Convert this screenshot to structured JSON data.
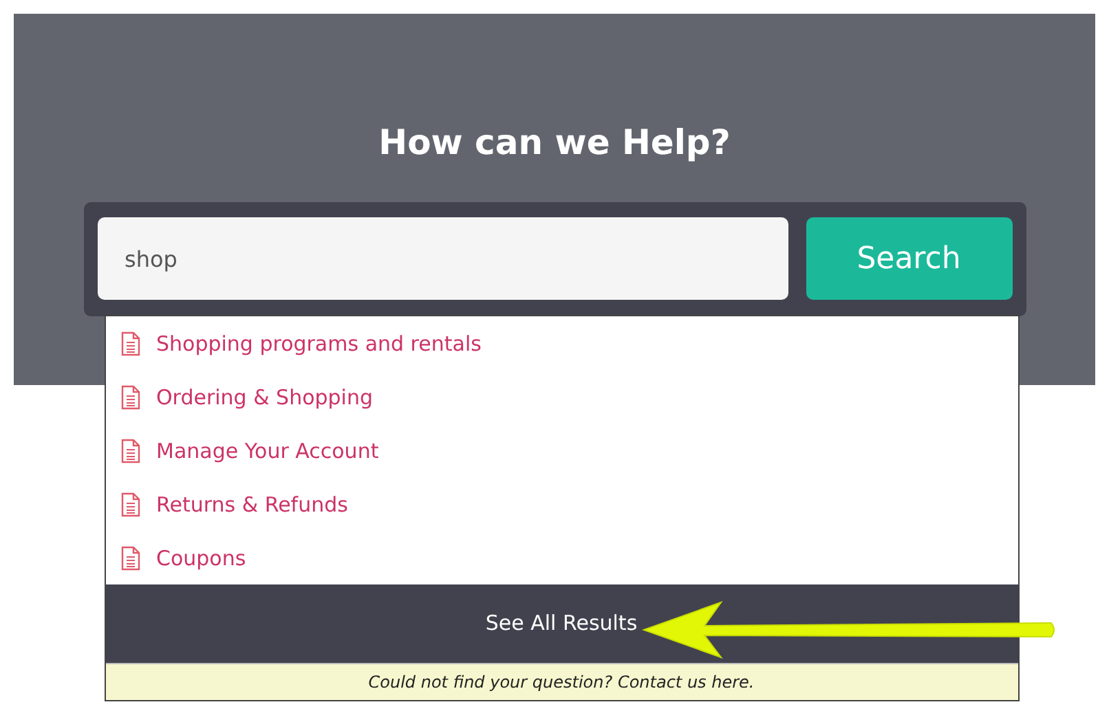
{
  "title": "How can we Help?",
  "search": {
    "value": "shop",
    "button": "Search"
  },
  "results": [
    {
      "label": "Shopping programs and rentals"
    },
    {
      "label": "Ordering & Shopping"
    },
    {
      "label": "Manage Your Account"
    },
    {
      "label": "Returns & Refunds"
    },
    {
      "label": "Coupons"
    }
  ],
  "see_all": "See All Results",
  "contact": "Could not find your question? Contact us here."
}
